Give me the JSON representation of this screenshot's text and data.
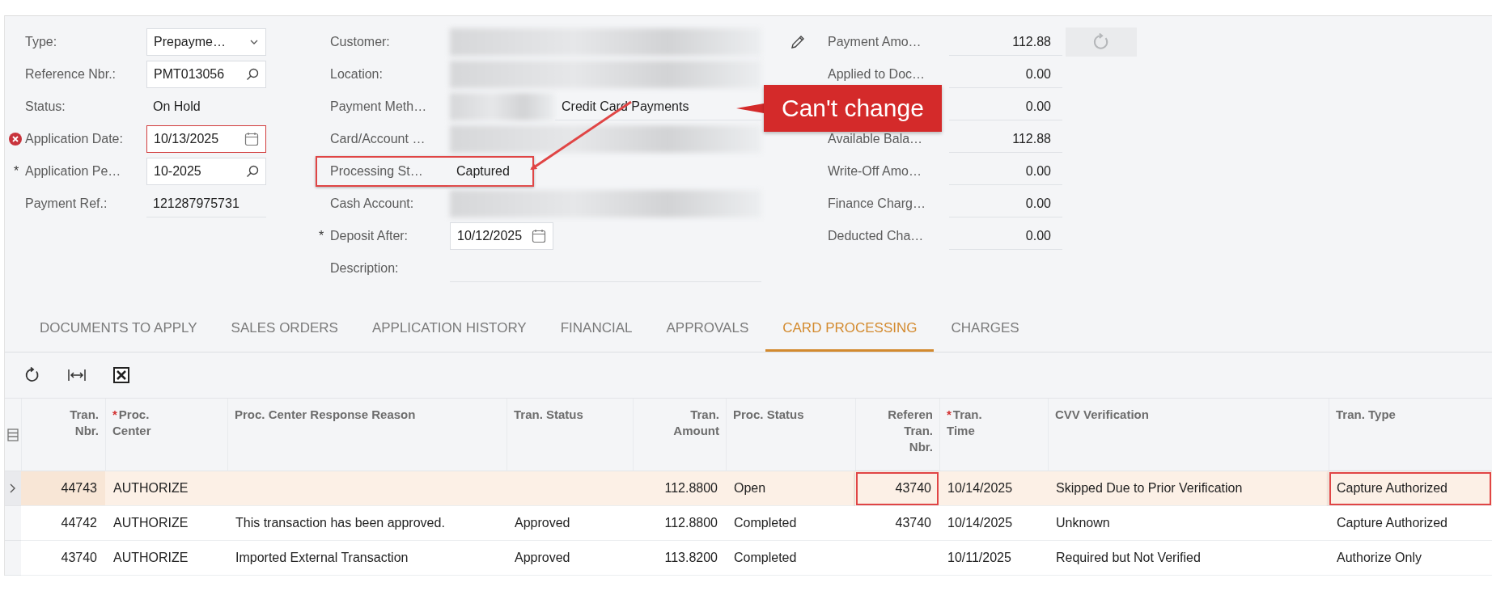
{
  "form": {
    "columns": [
      {
        "fields": [
          {
            "label": "Type:",
            "kind": "select",
            "value": "Prepayme…"
          },
          {
            "label": "Reference Nbr.:",
            "kind": "lookup",
            "value": "PMT013056"
          },
          {
            "label": "Status:",
            "kind": "static",
            "value": "On Hold"
          },
          {
            "label": "Application Date:",
            "kind": "date",
            "value": "10/13/2025",
            "error": true
          },
          {
            "label": "Application Pe…",
            "kind": "lookup",
            "value": "10-2025",
            "marker": "*"
          },
          {
            "label": "Payment Ref.:",
            "kind": "text",
            "value": "121287975731"
          }
        ]
      },
      {
        "fields": [
          {
            "label": "Customer:",
            "kind": "blurred"
          },
          {
            "label": "Location:",
            "kind": "blurred"
          },
          {
            "label": "Payment Meth…",
            "kind": "partly_blurred",
            "value": "Credit Card Payments"
          },
          {
            "label": "Card/Account …",
            "kind": "blurred"
          },
          {
            "label": "Processing St…",
            "kind": "static",
            "value": "Captured",
            "highlighted": true
          },
          {
            "label": "Cash Account:",
            "kind": "blurred"
          },
          {
            "label": "Deposit After:",
            "kind": "date",
            "value": "10/12/2025",
            "marker": "*"
          },
          {
            "label": "Description:",
            "kind": "text"
          }
        ]
      },
      {
        "fields": [
          {
            "label": "Payment Amo…",
            "kind": "amount",
            "value": "112.88"
          },
          {
            "label": "Applied to Doc…",
            "kind": "amount",
            "value": "0.00"
          },
          {
            "kind": "amount",
            "value": "0.00"
          },
          {
            "label": "Available Bala…",
            "kind": "amount",
            "value": "112.88"
          },
          {
            "label": "Write-Off Amo…",
            "kind": "amount",
            "value": "0.00"
          },
          {
            "label": "Finance Charg…",
            "kind": "amount",
            "value": "0.00"
          },
          {
            "label": "Deducted Cha…",
            "kind": "amount",
            "value": "0.00"
          }
        ]
      }
    ]
  },
  "callout": {
    "text": "Can't change"
  },
  "tabs": [
    {
      "label": "DOCUMENTS TO APPLY",
      "selected": false
    },
    {
      "label": "SALES ORDERS",
      "selected": false
    },
    {
      "label": "APPLICATION HISTORY",
      "selected": false
    },
    {
      "label": "FINANCIAL",
      "selected": false
    },
    {
      "label": "APPROVALS",
      "selected": false
    },
    {
      "label": "CARD PROCESSING",
      "selected": true
    },
    {
      "label": "CHARGES",
      "selected": false
    }
  ],
  "table": {
    "columns": [
      {
        "label": "Tran.\nNbr."
      },
      {
        "label": "Proc.\nCenter",
        "marker": "*"
      },
      {
        "label": "Proc. Center Response Reason"
      },
      {
        "label": "Tran. Status"
      },
      {
        "label": "Tran.\nAmount"
      },
      {
        "label": "Proc. Status"
      },
      {
        "label": "Referen\nTran.\nNbr."
      },
      {
        "label": "Tran.\nTime",
        "marker": "*"
      },
      {
        "label": "CVV Verification"
      },
      {
        "label": "Tran. Type"
      }
    ],
    "rows": [
      {
        "selected": true,
        "cells": [
          {
            "text": "44743",
            "highlighted": false
          },
          {
            "text": "AUTHORIZE",
            "highlighted": false
          },
          {
            "text": "",
            "highlighted": false
          },
          {
            "text": "",
            "highlighted": false
          },
          {
            "text": "112.8800",
            "highlighted": false
          },
          {
            "text": "Open",
            "highlighted": false
          },
          {
            "text": "43740",
            "highlighted": true
          },
          {
            "text": "10/14/2025",
            "highlighted": false
          },
          {
            "text": "Skipped Due to Prior Verification",
            "highlighted": false
          },
          {
            "text": "Capture Authorized",
            "highlighted": true
          }
        ]
      },
      {
        "selected": false,
        "cells": [
          {
            "text": "44742",
            "highlighted": false
          },
          {
            "text": "AUTHORIZE",
            "highlighted": false
          },
          {
            "text": "This transaction has been approved.",
            "highlighted": false
          },
          {
            "text": "Approved",
            "highlighted": false
          },
          {
            "text": "112.8800",
            "highlighted": false
          },
          {
            "text": "Completed",
            "highlighted": false
          },
          {
            "text": "43740",
            "highlighted": false
          },
          {
            "text": "10/14/2025",
            "highlighted": false
          },
          {
            "text": "Unknown",
            "highlighted": false
          },
          {
            "text": "Capture Authorized",
            "highlighted": false
          }
        ]
      },
      {
        "selected": false,
        "cells": [
          {
            "text": "43740",
            "highlighted": false
          },
          {
            "text": "AUTHORIZE",
            "highlighted": false
          },
          {
            "text": "Imported External Transaction",
            "highlighted": false
          },
          {
            "text": "Approved",
            "highlighted": false
          },
          {
            "text": "113.8200",
            "highlighted": false
          },
          {
            "text": "Completed",
            "highlighted": false
          },
          {
            "text": "",
            "highlighted": false
          },
          {
            "text": "10/11/2025",
            "highlighted": false
          },
          {
            "text": "Required but Not Verified",
            "highlighted": false
          },
          {
            "text": "Authorize Only",
            "highlighted": false
          }
        ]
      }
    ]
  }
}
